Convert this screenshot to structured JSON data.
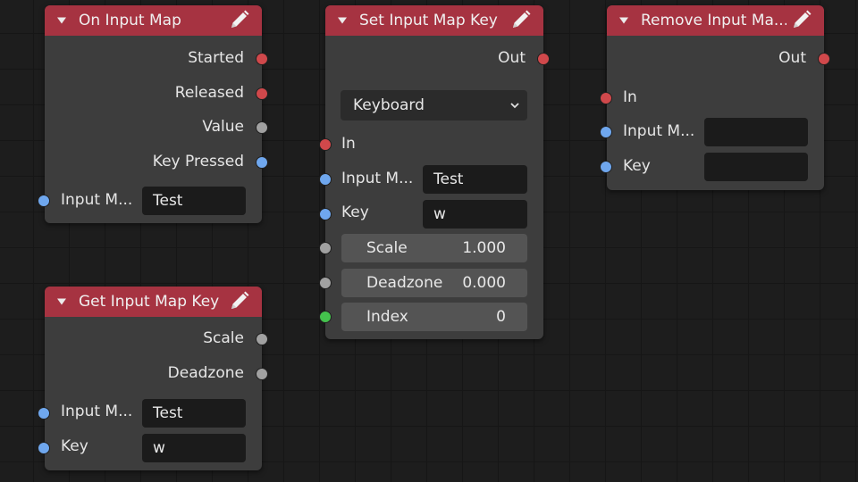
{
  "nodes": {
    "on_input_map": {
      "title": "On Input Map",
      "outputs": [
        "Started",
        "Released",
        "Value",
        "Key Pressed"
      ],
      "input_label": "Input M...",
      "input_value": "Test"
    },
    "get_input_map_key": {
      "title": "Get Input Map Key",
      "outputs": [
        "Scale",
        "Deadzone"
      ],
      "input_map_label": "Input M...",
      "input_map_value": "Test",
      "key_label": "Key",
      "key_value": "w"
    },
    "set_input_map_key": {
      "title": "Set Input Map Key",
      "out_label": "Out",
      "dropdown_value": "Keyboard",
      "in_label": "In",
      "input_map_label": "Input M...",
      "input_map_value": "Test",
      "key_label": "Key",
      "key_value": "w",
      "scale_label": "Scale",
      "scale_value": "1.000",
      "deadzone_label": "Deadzone",
      "deadzone_value": "0.000",
      "index_label": "Index",
      "index_value": "0"
    },
    "remove_input_map": {
      "title": "Remove Input Ma...",
      "out_label": "Out",
      "in_label": "In",
      "input_map_label": "Input M...",
      "input_map_value": "",
      "key_label": "Key",
      "key_value": ""
    }
  },
  "colors": {
    "header": "#a63341",
    "node_body": "#3d3d3d",
    "socket_exec": "#d0484b",
    "socket_string": "#6fa7ee",
    "socket_float": "#a1a1a1",
    "socket_int": "#44c24d"
  },
  "icons": [
    "collapse-icon",
    "pencil-icon",
    "chevron-down-icon"
  ]
}
